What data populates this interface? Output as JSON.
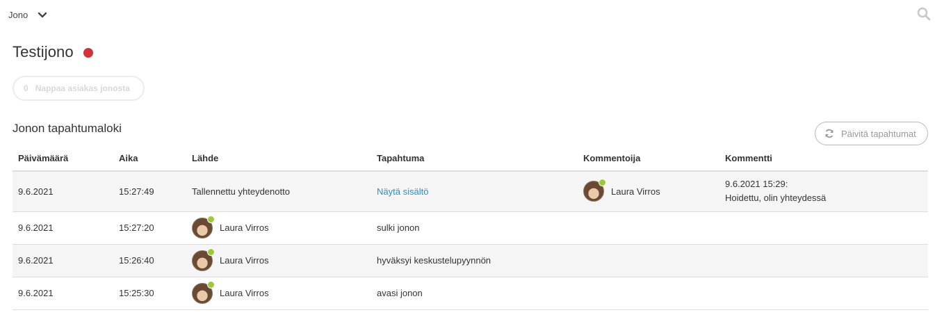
{
  "topbar": {
    "queue_label": "Jono",
    "chevron_icon": "chevron-down-icon",
    "search_icon": "search-icon"
  },
  "page": {
    "title": "Testijono",
    "status_color": "#d13438"
  },
  "grab_button": {
    "count": "0",
    "label": "Nappaa asiakas jonosta"
  },
  "log": {
    "title": "Jonon tapahtumaloki",
    "refresh_label": "Päivitä tapahtumat",
    "columns": [
      "Päivämäärä",
      "Aika",
      "Lähde",
      "Tapahtuma",
      "Kommentoija",
      "Kommentti"
    ],
    "rows": [
      {
        "date": "9.6.2021",
        "time": "15:27:49",
        "source": "Tallennettu yhteydenotto",
        "event": "Näytä sisältö",
        "commenter": "Laura Virros",
        "comment_time": "9.6.2021 15:29:",
        "comment_text": "Hoidettu, olin yhteydessä"
      },
      {
        "date": "9.6.2021",
        "time": "15:27:20",
        "source": "Laura Virros",
        "event": "sulki jonon"
      },
      {
        "date": "9.6.2021",
        "time": "15:26:40",
        "source": "Laura Virros",
        "event": "hyväksyi keskustelupyynnön"
      },
      {
        "date": "9.6.2021",
        "time": "15:25:30",
        "source": "Laura Virros",
        "event": "avasi jonon"
      }
    ]
  },
  "colors": {
    "link": "#2b8fc5",
    "online": "#9acb34"
  }
}
